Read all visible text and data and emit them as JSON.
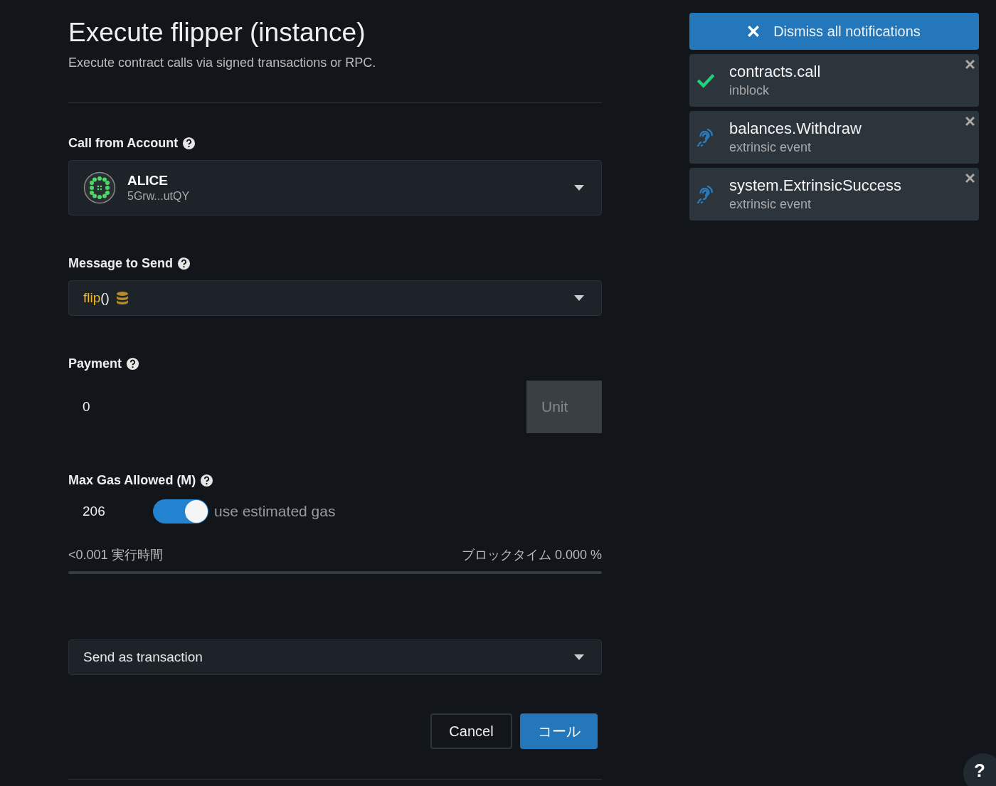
{
  "header": {
    "title": "Execute flipper (instance)",
    "subtitle": "Execute contract calls via signed transactions or RPC."
  },
  "account": {
    "label": "Call from Account",
    "name": "ALICE",
    "address": "5Grw...utQY"
  },
  "message": {
    "label": "Message to Send",
    "method": "flip",
    "args": "()"
  },
  "payment": {
    "label": "Payment",
    "value": "0",
    "unit": "Unit"
  },
  "gas": {
    "label": "Max Gas Allowed (M)",
    "value": "206",
    "toggle": {
      "on": true,
      "label": "use estimated gas"
    },
    "exec_time": "<0.001 実行時間",
    "block_time": "ブロックタイム 0.000 %",
    "level": 0
  },
  "send_mode": {
    "value": "Send as transaction"
  },
  "buttons": {
    "cancel": "Cancel",
    "call": "コール"
  },
  "notifications": {
    "dismiss_all": "Dismiss all notifications",
    "items": [
      {
        "kind": "success",
        "title": "contracts.call",
        "subtitle": "inblock"
      },
      {
        "kind": "event",
        "title": "balances.Withdraw",
        "subtitle": "extrinsic event"
      },
      {
        "kind": "event",
        "title": "system.ExtrinsicSuccess",
        "subtitle": "extrinsic event"
      }
    ]
  },
  "help": {
    "label": "?"
  }
}
